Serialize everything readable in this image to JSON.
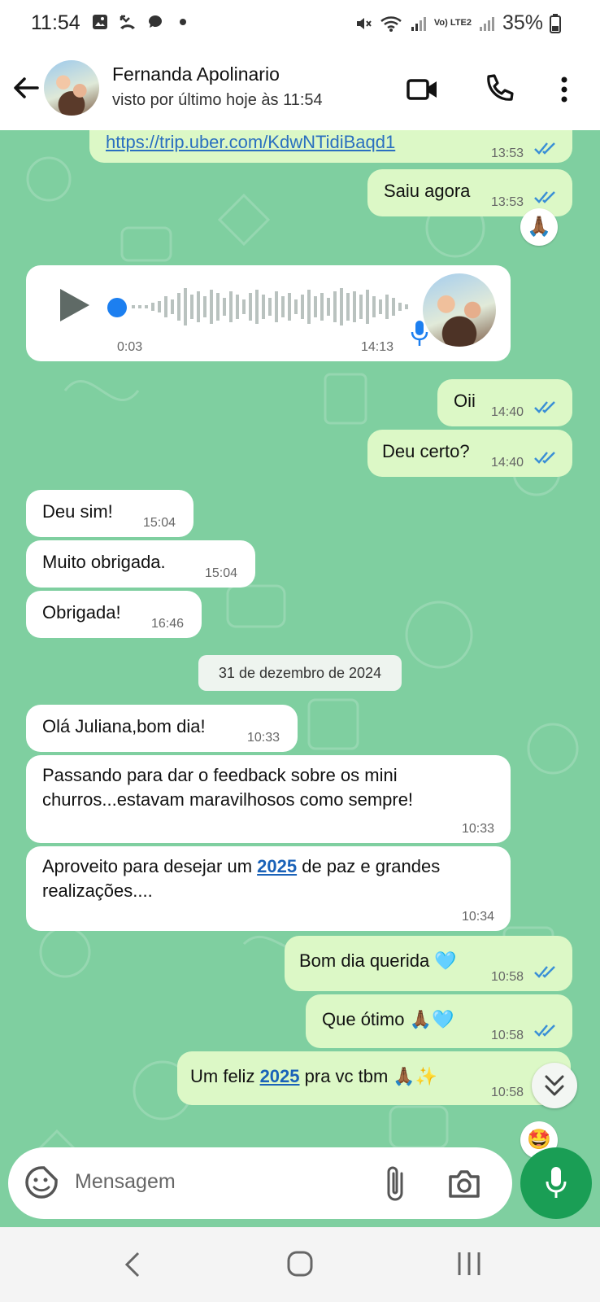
{
  "status_bar": {
    "time": "11:54",
    "battery": "35%",
    "network": "Vo) LTE2"
  },
  "header": {
    "contact_name": "Fernanda Apolinario",
    "last_seen": "visto por último hoje às 11:54"
  },
  "messages": [
    {
      "id": "m1",
      "direction": "out",
      "text": "https://trip.uber.com/KdwNTidiBaqd1",
      "time": "13:53",
      "read": true
    },
    {
      "id": "m2",
      "direction": "out",
      "text": "Saiu agora",
      "time": "13:53",
      "read": true,
      "reaction": "🙏🏾"
    },
    {
      "id": "m3",
      "direction": "in",
      "type": "voice",
      "duration": "0:03",
      "time": "14:13"
    },
    {
      "id": "m4",
      "direction": "out",
      "text": "Oii",
      "time": "14:40",
      "read": true
    },
    {
      "id": "m5",
      "direction": "out",
      "text": "Deu certo?",
      "time": "14:40",
      "read": true
    },
    {
      "id": "m6",
      "direction": "in",
      "text": "Deu sim!",
      "time": "15:04"
    },
    {
      "id": "m7",
      "direction": "in",
      "text": "Muito obrigada.",
      "time": "15:04"
    },
    {
      "id": "m8",
      "direction": "in",
      "text": "Obrigada!",
      "time": "16:46"
    },
    {
      "id": "m9",
      "direction": "in",
      "text": "Olá Juliana,bom dia!",
      "time": "10:33"
    },
    {
      "id": "m10",
      "direction": "in",
      "line1": "Passando para dar o feedback sobre os mini",
      "line2": "churros...estavam maravilhosos como sempre!",
      "time": "10:33"
    },
    {
      "id": "m11",
      "direction": "in",
      "line1_a": "Aproveito para desejar um ",
      "line1_link": "2025",
      "line1_b": " de paz e grandes",
      "line2": "realizações....",
      "time": "10:34"
    },
    {
      "id": "m12",
      "direction": "out",
      "text": "Bom dia querida 🩵",
      "time": "10:58",
      "read": true
    },
    {
      "id": "m13",
      "direction": "out",
      "text": "Que ótimo 🙏🏾🩵",
      "time": "10:58",
      "read": true
    },
    {
      "id": "m14",
      "direction": "out",
      "text_a": "Um feliz ",
      "text_link": "2025",
      "text_b": " pra vc tbm 🙏🏾✨",
      "time": "10:58",
      "reaction": "🤩"
    }
  ],
  "date_divider": "31 de dezembro de 2024",
  "composer": {
    "placeholder": "Mensagem"
  },
  "colors": {
    "chat_bg": "#7fcfa0",
    "outgoing": "#dcf8c6",
    "incoming": "#ffffff",
    "read_ticks": "#3a8fd6",
    "mic_button": "#1a9e55"
  }
}
